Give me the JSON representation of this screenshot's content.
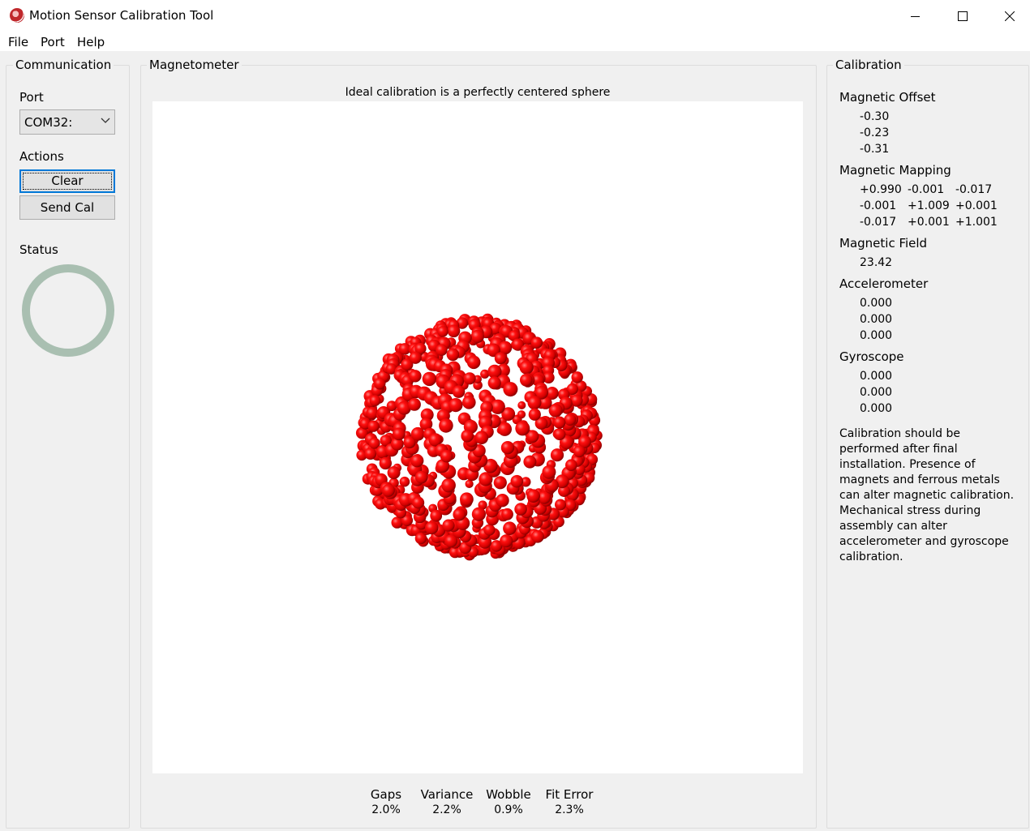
{
  "window": {
    "title": "Motion Sensor Calibration Tool"
  },
  "menu": [
    "File",
    "Port",
    "Help"
  ],
  "communication": {
    "title": "Communication",
    "port_label": "Port",
    "port_value": "COM32:",
    "actions_label": "Actions",
    "clear_label": "Clear",
    "send_cal_label": "Send Cal",
    "status_label": "Status"
  },
  "magnetometer": {
    "title": "Magnetometer",
    "subtitle": "Ideal calibration is a perfectly centered sphere",
    "point_color": "#e00000",
    "stats": [
      {
        "label": "Gaps",
        "value": "2.0%"
      },
      {
        "label": "Variance",
        "value": "2.2%"
      },
      {
        "label": "Wobble",
        "value": "0.9%"
      },
      {
        "label": "Fit Error",
        "value": "2.3%"
      }
    ]
  },
  "calibration": {
    "title": "Calibration",
    "offset_label": "Magnetic Offset",
    "offset": [
      "-0.30",
      "-0.23",
      "-0.31"
    ],
    "mapping_label": "Magnetic Mapping",
    "mapping": [
      [
        "+0.990",
        "-0.001",
        "-0.017"
      ],
      [
        "-0.001",
        "+1.009",
        "+0.001"
      ],
      [
        "-0.017",
        "+0.001",
        "+1.001"
      ]
    ],
    "field_label": "Magnetic Field",
    "field": "23.42",
    "accel_label": "Accelerometer",
    "accel": [
      "0.000",
      "0.000",
      "0.000"
    ],
    "gyro_label": "Gyroscope",
    "gyro": [
      "0.000",
      "0.000",
      "0.000"
    ],
    "note": "Calibration should be performed after final installation.  Presence of magnets and ferrous metals can alter magnetic calibration. Mechanical stress during assembly can alter accelerometer and gyroscope calibration."
  },
  "colors": {
    "status_ring": "#a9bfb1",
    "focus_border": "#0078d7"
  }
}
